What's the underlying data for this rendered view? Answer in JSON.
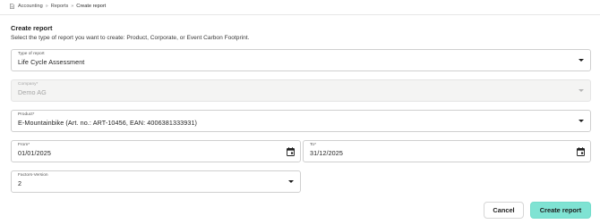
{
  "breadcrumb": {
    "icon": "document-icon",
    "items": [
      "Accounting",
      "Reports",
      "Create report"
    ],
    "separator": "»"
  },
  "page": {
    "title": "Create report",
    "subtitle": "Select the type of report you want to create: Product, Corporate, or Event Carbon Footprint."
  },
  "form": {
    "type_of_report": {
      "label": "Type of report",
      "value": "Life Cycle Assessment"
    },
    "company": {
      "label": "Company*",
      "value": "Demo AG",
      "disabled": true
    },
    "product": {
      "label": "Product*",
      "value": "E-Mountainbike (Art. no.: ART-10456, EAN: 4006381333931)"
    },
    "from": {
      "label": "From*",
      "value": "01/01/2025"
    },
    "to": {
      "label": "To*",
      "value": "31/12/2025"
    },
    "factors_version": {
      "label": "Factors-Version",
      "value": "2"
    }
  },
  "actions": {
    "cancel_label": "Cancel",
    "create_label": "Create report"
  },
  "colors": {
    "accent": "#7fe3d3",
    "disabled_bg": "#f4f4f3"
  }
}
